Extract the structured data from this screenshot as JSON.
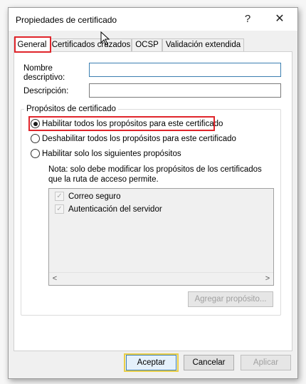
{
  "window": {
    "title": "Propiedades de certificado",
    "help_glyph": "?",
    "close_glyph": "✕"
  },
  "tabs": [
    {
      "label": "General",
      "active": true
    },
    {
      "label": "Certificados cruzados",
      "active": false
    },
    {
      "label": "OCSP",
      "active": false
    },
    {
      "label": "Validación extendida",
      "active": false
    }
  ],
  "general": {
    "friendly_name_label_line1": "Nombre",
    "friendly_name_label_line2": "descriptivo:",
    "friendly_name_value": "",
    "description_label": "Descripción:",
    "description_value": ""
  },
  "purposes": {
    "group_title": "Propósitos de certificado",
    "options": [
      {
        "label": "Habilitar todos los propósitos para este certificado",
        "checked": true
      },
      {
        "label": "Deshabilitar todos los propósitos para este certificado",
        "checked": false
      },
      {
        "label": "Habilitar solo los siguientes propósitos",
        "checked": false
      }
    ],
    "note": "Nota: solo debe modificar los propósitos de los certificados que la ruta de acceso permite.",
    "list_items": [
      {
        "label": "Correo seguro",
        "checked": true
      },
      {
        "label": "Autenticación del servidor",
        "checked": true
      }
    ],
    "scroll_left": "<",
    "scroll_right": ">",
    "add_purpose_button": "Agregar propósito..."
  },
  "footer": {
    "ok_button": "Aceptar",
    "cancel_button": "Cancelar",
    "apply_button": "Aplicar"
  },
  "colors": {
    "highlight_red": "#e0252b",
    "highlight_yellow": "#e9cf4a",
    "focus_blue": "#3c7fb1"
  }
}
